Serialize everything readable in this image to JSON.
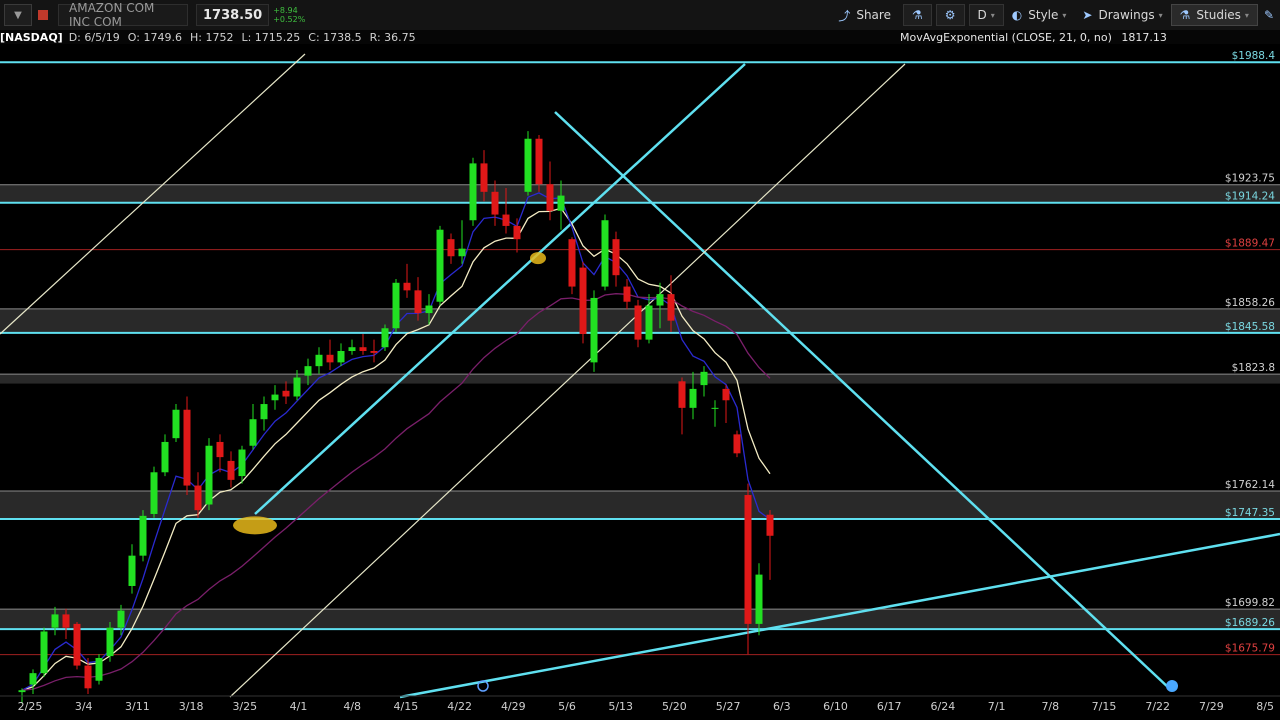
{
  "header": {
    "symbol_name": "AMAZON COM INC COM",
    "last_price": "1738.50",
    "change_abs": "+8.94",
    "change_pct": "+0.52%",
    "buttons": [
      {
        "label": "Share",
        "icon": "share-icon"
      },
      {
        "label": "",
        "icon": "flask-icon"
      },
      {
        "label": "",
        "icon": "gear-icon"
      },
      {
        "label": "D",
        "icon": ""
      },
      {
        "label": "Style",
        "icon": "style-icon"
      },
      {
        "label": "Drawings",
        "icon": "cursor-icon"
      },
      {
        "label": "Studies",
        "icon": "flask-icon"
      }
    ]
  },
  "info_bar": {
    "symbol": "[NASDAQ]",
    "date": "D: 6/5/19",
    "open": "O: 1749.6",
    "high": "H: 1752",
    "low": "L: 1715.25",
    "close": "C: 1738.5",
    "range": "R: 36.75",
    "study": "MovAvgExponential (CLOSE, 21, 0, no)",
    "study_value": "1817.13"
  },
  "chart_data": {
    "type": "candlestick",
    "ylim": [
      1655,
      1998
    ],
    "x_ticks": [
      "2/25",
      "3/4",
      "3/11",
      "3/18",
      "3/25",
      "4/1",
      "4/8",
      "4/15",
      "4/22",
      "4/29",
      "5/6",
      "5/13",
      "5/20",
      "5/27",
      "6/3",
      "6/10",
      "6/17",
      "6/24",
      "7/1",
      "7/8",
      "7/15",
      "7/22",
      "7/29",
      "8/5"
    ],
    "price_levels": [
      {
        "value": 1988.4,
        "label": "$1988.4",
        "color": "#7ad7e0"
      },
      {
        "value": 1923.75,
        "label": "$1923.75",
        "color": "#d0d0d0"
      },
      {
        "value": 1914.24,
        "label": "$1914.24",
        "color": "#7ad7e0"
      },
      {
        "value": 1889.47,
        "label": "$1889.47",
        "color": "#e04040"
      },
      {
        "value": 1858.26,
        "label": "$1858.26",
        "color": "#d0d0d0"
      },
      {
        "value": 1845.58,
        "label": "$1845.58",
        "color": "#7ad7e0"
      },
      {
        "value": 1823.8,
        "label": "$1823.8",
        "color": "#d0d0d0"
      },
      {
        "value": 1762.14,
        "label": "$1762.14",
        "color": "#d0d0d0"
      },
      {
        "value": 1747.35,
        "label": "$1747.35",
        "color": "#7ad7e0"
      },
      {
        "value": 1699.82,
        "label": "$1699.82",
        "color": "#d0d0d0"
      },
      {
        "value": 1689.26,
        "label": "$1689.26",
        "color": "#7ad7e0"
      },
      {
        "value": 1675.79,
        "label": "$1675.79",
        "color": "#e04040"
      }
    ],
    "candles": [
      [
        0,
        1656,
        1658,
        1650,
        1657
      ],
      [
        1,
        1660,
        1668,
        1655,
        1666
      ],
      [
        2,
        1666,
        1690,
        1664,
        1688
      ],
      [
        3,
        1690,
        1701,
        1686,
        1697
      ],
      [
        4,
        1697,
        1700,
        1684,
        1690
      ],
      [
        5,
        1692,
        1693,
        1668,
        1670
      ],
      [
        6,
        1670,
        1674,
        1655,
        1658
      ],
      [
        7,
        1662,
        1676,
        1660,
        1674
      ],
      [
        8,
        1675,
        1693,
        1672,
        1690
      ],
      [
        9,
        1690,
        1702,
        1686,
        1699
      ],
      [
        10,
        1712,
        1734,
        1708,
        1728
      ],
      [
        11,
        1728,
        1752,
        1725,
        1749
      ],
      [
        12,
        1750,
        1775,
        1748,
        1772
      ],
      [
        13,
        1772,
        1792,
        1770,
        1788
      ],
      [
        14,
        1790,
        1808,
        1788,
        1805
      ],
      [
        15,
        1805,
        1812,
        1760,
        1765
      ],
      [
        16,
        1765,
        1772,
        1748,
        1752
      ],
      [
        17,
        1755,
        1790,
        1752,
        1786
      ],
      [
        18,
        1788,
        1792,
        1772,
        1780
      ],
      [
        19,
        1778,
        1783,
        1764,
        1768
      ],
      [
        20,
        1770,
        1786,
        1766,
        1784
      ],
      [
        21,
        1786,
        1808,
        1784,
        1800
      ],
      [
        22,
        1800,
        1812,
        1794,
        1808
      ],
      [
        23,
        1810,
        1818,
        1805,
        1813
      ],
      [
        24,
        1815,
        1820,
        1808,
        1812
      ],
      [
        25,
        1812,
        1826,
        1810,
        1822
      ],
      [
        26,
        1823,
        1832,
        1818,
        1828
      ],
      [
        27,
        1828,
        1838,
        1824,
        1834
      ],
      [
        28,
        1834,
        1842,
        1826,
        1830
      ],
      [
        29,
        1830,
        1840,
        1828,
        1836
      ],
      [
        30,
        1836,
        1842,
        1834,
        1838
      ],
      [
        31,
        1838,
        1845,
        1834,
        1836
      ],
      [
        32,
        1836,
        1842,
        1830,
        1835
      ],
      [
        33,
        1838,
        1850,
        1836,
        1848
      ],
      [
        34,
        1848,
        1874,
        1846,
        1872
      ],
      [
        35,
        1872,
        1882,
        1864,
        1868
      ],
      [
        36,
        1868,
        1875,
        1852,
        1856
      ],
      [
        37,
        1856,
        1866,
        1850,
        1860
      ],
      [
        38,
        1862,
        1902,
        1860,
        1900
      ],
      [
        39,
        1895,
        1898,
        1882,
        1886
      ],
      [
        40,
        1886,
        1905,
        1882,
        1890
      ],
      [
        41,
        1905,
        1938,
        1902,
        1935
      ],
      [
        42,
        1935,
        1942,
        1915,
        1920
      ],
      [
        43,
        1920,
        1926,
        1902,
        1908
      ],
      [
        44,
        1908,
        1922,
        1898,
        1902
      ],
      [
        45,
        1902,
        1906,
        1888,
        1895
      ],
      [
        46,
        1920,
        1952,
        1918,
        1948
      ],
      [
        47,
        1948,
        1950,
        1920,
        1924
      ],
      [
        48,
        1924,
        1936,
        1905,
        1910
      ],
      [
        49,
        1910,
        1926,
        1900,
        1918
      ],
      [
        50,
        1895,
        1896,
        1866,
        1870
      ],
      [
        51,
        1880,
        1883,
        1840,
        1845
      ],
      [
        52,
        1830,
        1868,
        1825,
        1864
      ],
      [
        53,
        1870,
        1908,
        1868,
        1905
      ],
      [
        54,
        1895,
        1899,
        1870,
        1876
      ],
      [
        55,
        1870,
        1874,
        1858,
        1862
      ],
      [
        56,
        1860,
        1863,
        1838,
        1842
      ],
      [
        57,
        1842,
        1866,
        1840,
        1860
      ],
      [
        58,
        1860,
        1872,
        1848,
        1866
      ],
      [
        59,
        1866,
        1876,
        1846,
        1852
      ],
      [
        60,
        1820,
        1822,
        1792,
        1806
      ],
      [
        61,
        1806,
        1825,
        1800,
        1816
      ],
      [
        62,
        1818,
        1828,
        1812,
        1825
      ],
      [
        63,
        1806,
        1810,
        1796,
        1806
      ],
      [
        64,
        1816,
        1818,
        1798,
        1810
      ],
      [
        65,
        1792,
        1794,
        1780,
        1782
      ],
      [
        66,
        1760,
        1766,
        1676,
        1692
      ],
      [
        67,
        1692,
        1724,
        1686,
        1718
      ],
      [
        68,
        1749.6,
        1752,
        1715.25,
        1738.5
      ]
    ],
    "moving_averages": [
      {
        "name": "MovAvgExponential (CLOSE, 21, 0, no)",
        "value": 1817.13
      }
    ]
  }
}
